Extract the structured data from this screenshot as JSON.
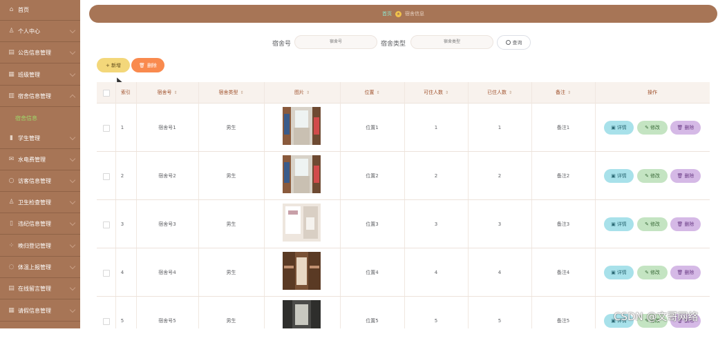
{
  "sidebar": {
    "items": [
      {
        "label": "首页",
        "icon": "home-icon",
        "chevron": false
      },
      {
        "label": "个人中心",
        "icon": "user-icon",
        "chevron": true
      },
      {
        "label": "公告信息管理",
        "icon": "notice-icon",
        "chevron": true
      },
      {
        "label": "班级管理",
        "icon": "class-icon",
        "chevron": true
      },
      {
        "label": "宿舍信息管理",
        "icon": "dorm-icon",
        "chevron": true
      },
      {
        "label": "学生管理",
        "icon": "student-icon",
        "chevron": true
      },
      {
        "label": "水电费管理",
        "icon": "utility-icon",
        "chevron": true
      },
      {
        "label": "访客信息管理",
        "icon": "visitor-icon",
        "chevron": true
      },
      {
        "label": "卫生检查管理",
        "icon": "hygiene-icon",
        "chevron": true
      },
      {
        "label": "违纪信息管理",
        "icon": "violation-icon",
        "chevron": true
      },
      {
        "label": "晚归登记管理",
        "icon": "late-return-icon",
        "chevron": true
      },
      {
        "label": "体温上报管理",
        "icon": "temperature-icon",
        "chevron": true
      },
      {
        "label": "在线留言管理",
        "icon": "message-icon",
        "chevron": true
      },
      {
        "label": "请假信息管理",
        "icon": "leave-icon",
        "chevron": true
      }
    ],
    "submenu_label": "宿舍信息"
  },
  "breadcrumb": {
    "home": "首页",
    "current": "宿舍信息"
  },
  "search": {
    "dorm_no_label": "宿舍号",
    "dorm_no_placeholder": "宿舍号",
    "dorm_type_label": "宿舍类型",
    "dorm_type_placeholder": "宿舍类型",
    "query_label": "查询"
  },
  "toolbar": {
    "add_label": "+ 新增",
    "delete_label": "删除"
  },
  "table": {
    "headers": [
      "索引",
      "宿舍号",
      "宿舍类型",
      "图片",
      "位置",
      "可住人数",
      "已住人数",
      "备注",
      "操作"
    ],
    "rows": [
      {
        "index": "1",
        "dorm_no": "宿舍号1",
        "type": "男生",
        "location": "位置1",
        "capacity": "1",
        "occupied": "1",
        "remark": "备注1",
        "photo": "dorm-photo-1"
      },
      {
        "index": "2",
        "dorm_no": "宿舍号2",
        "type": "男生",
        "location": "位置2",
        "capacity": "2",
        "occupied": "2",
        "remark": "备注2",
        "photo": "dorm-photo-2"
      },
      {
        "index": "3",
        "dorm_no": "宿舍号3",
        "type": "男生",
        "location": "位置3",
        "capacity": "3",
        "occupied": "3",
        "remark": "备注3",
        "photo": "dorm-photo-3"
      },
      {
        "index": "4",
        "dorm_no": "宿舍号4",
        "type": "男生",
        "location": "位置4",
        "capacity": "4",
        "occupied": "4",
        "remark": "备注4",
        "photo": "dorm-photo-4"
      },
      {
        "index": "5",
        "dorm_no": "宿舍号5",
        "type": "男生",
        "location": "位置5",
        "capacity": "5",
        "occupied": "5",
        "remark": "备注5",
        "photo": "dorm-photo-5"
      }
    ],
    "op_detail": "详情",
    "op_edit": "修改",
    "op_delete": "删除"
  },
  "watermark": "CSDN @文哥网络",
  "colors": {
    "sidebar_bg": "#a77556",
    "submenu_active": "#9fd86a",
    "header_text": "#a0522d",
    "add_button": "#f3d77a",
    "delete_button": "#f98a4e",
    "detail_button": "#a8e1ea",
    "edit_button": "#c4e4c2",
    "row_delete_button": "#d5b9e6"
  }
}
